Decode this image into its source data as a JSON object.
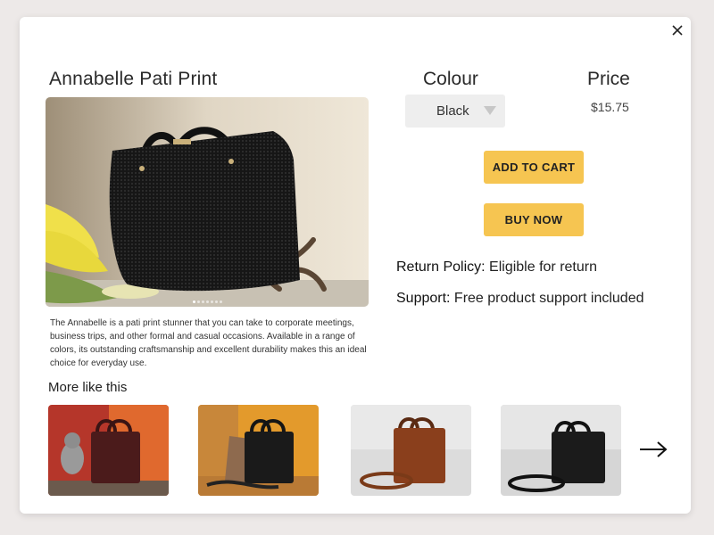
{
  "product": {
    "title": "Annabelle Pati Print",
    "description": "The Annabelle is a pati print stunner that you can take to corporate meetings, business trips, and other formal and casual occasions. Available in a range of colors, its outstanding craftsmanship and excellent durability makes this an ideal choice for everyday use."
  },
  "colour": {
    "label": "Colour",
    "selected": "Black"
  },
  "price": {
    "label": "Price",
    "value": "$15.75"
  },
  "buttons": {
    "add_to_cart": "ADD TO CART",
    "buy_now": "BUY NOW"
  },
  "policy": {
    "return_label": "Return Policy:",
    "return_value": " Eligible for return",
    "support_label": "Support:",
    "support_value": " Free product support included"
  },
  "more": {
    "title": "More like this",
    "items": [
      {
        "colour_name": "maroon",
        "background": "red-orange split"
      },
      {
        "colour_name": "black",
        "background": "orange"
      },
      {
        "colour_name": "tan",
        "background": "light grey"
      },
      {
        "colour_name": "black",
        "background": "light grey"
      }
    ]
  },
  "carousel": {
    "dots": 7,
    "active_index": 0
  },
  "colors": {
    "accent": "#f6c551",
    "select_bg": "#eeeeee",
    "page_bg": "#ede9e8"
  },
  "icons": {
    "close": "close-icon",
    "caret": "chevron-down-icon",
    "next": "arrow-right-icon"
  }
}
